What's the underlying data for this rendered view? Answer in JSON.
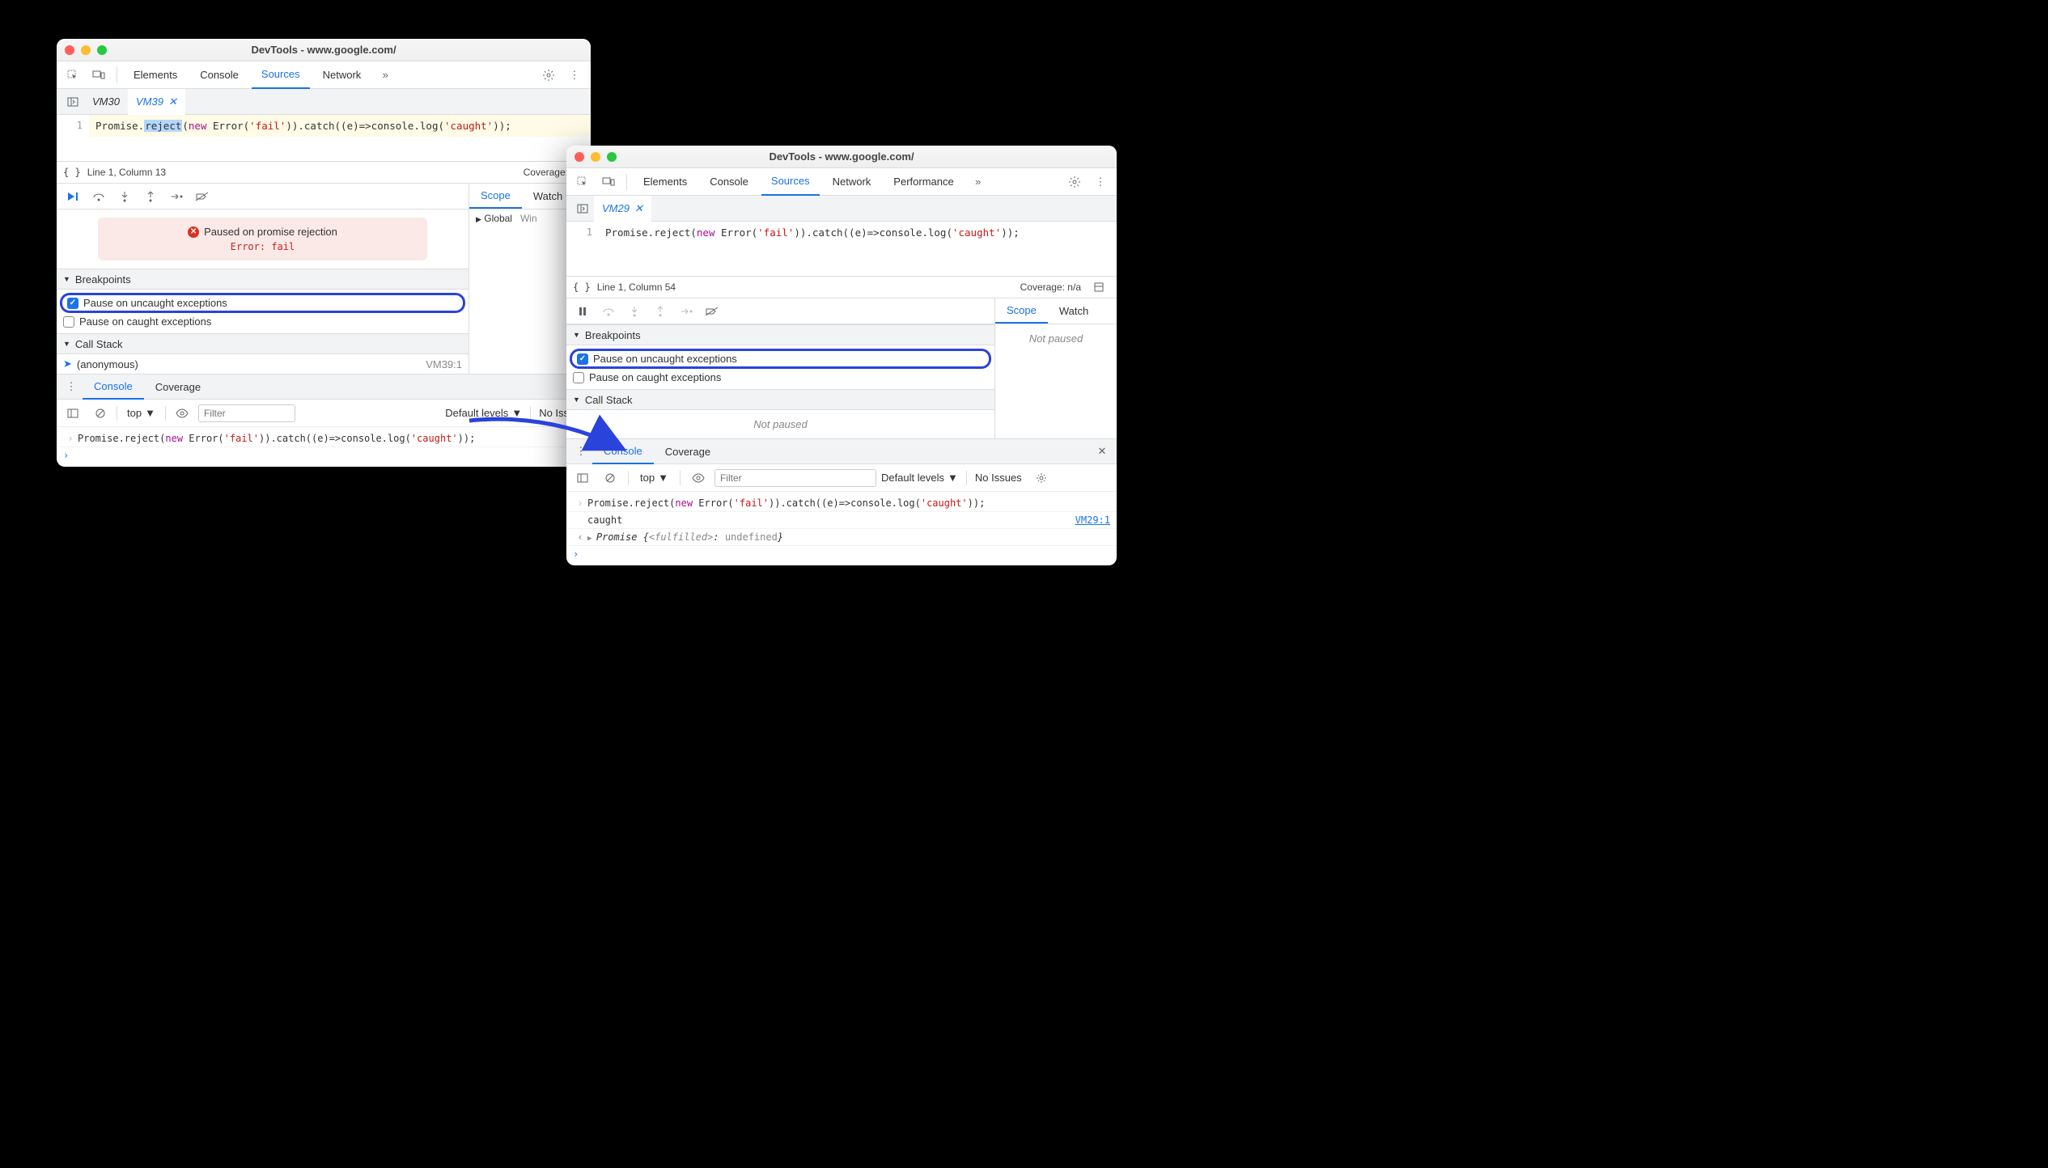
{
  "left": {
    "title": "DevTools - www.google.com/",
    "panels": [
      "Elements",
      "Console",
      "Sources",
      "Network"
    ],
    "activePanel": "Sources",
    "more": "»",
    "fileTabs": {
      "inactive": "VM30",
      "active": "VM39"
    },
    "editor": {
      "lineNo": "1",
      "tokens": {
        "t0": "Promise.",
        "t1": "reject",
        "t2": "(",
        "t3": "new",
        "t4": " Error(",
        "t5": "'fail'",
        "t6": ")).catch((e)=>console.log(",
        "t7": "'caught'",
        "t8": "));"
      }
    },
    "status": {
      "pos": "Line 1, Column 13",
      "coverage": "Coverage: n/a"
    },
    "rightPane": {
      "tabs": [
        "Scope",
        "Watch"
      ],
      "activeTab": "Scope",
      "scope": {
        "globalLabel": "Global",
        "globalVal": "Win"
      }
    },
    "pauseBanner": {
      "title": "Paused on promise rejection",
      "error": "Error: fail"
    },
    "breakpoints": {
      "header": "Breakpoints",
      "uncaught": "Pause on uncaught exceptions",
      "caught": "Pause on caught exceptions"
    },
    "callstack": {
      "header": "Call Stack",
      "frame": "(anonymous)",
      "frameLoc": "VM39:1"
    },
    "drawer": {
      "tabs": [
        "Console",
        "Coverage"
      ],
      "activeTab": "Console",
      "context": "top",
      "filterPlaceholder": "Filter",
      "levels": "Default levels",
      "issues": "No Issues",
      "rows": [
        {
          "kind": "input",
          "tokens": {
            "t0": "Promise.reject(",
            "t1": "new",
            "t2": " Error(",
            "t3": "'fail'",
            "t4": ")).catch((e)=>console.log(",
            "t5": "'caught'",
            "t6": "));"
          }
        }
      ]
    }
  },
  "right": {
    "title": "DevTools - www.google.com/",
    "panels": [
      "Elements",
      "Console",
      "Sources",
      "Network",
      "Performance"
    ],
    "activePanel": "Sources",
    "more": "»",
    "fileTabs": {
      "active": "VM29"
    },
    "editor": {
      "lineNo": "1",
      "tokens": {
        "t0": "Promise.reject(",
        "t1": "new",
        "t2": " Error(",
        "t3": "'fail'",
        "t4": ")).catch((e)=>console.log(",
        "t5": "'caught'",
        "t6": "));"
      }
    },
    "status": {
      "pos": "Line 1, Column 54",
      "coverage": "Coverage: n/a"
    },
    "rightPane": {
      "tabs": [
        "Scope",
        "Watch"
      ],
      "activeTab": "Scope",
      "notPaused": "Not paused"
    },
    "breakpoints": {
      "header": "Breakpoints",
      "uncaught": "Pause on uncaught exceptions",
      "caught": "Pause on caught exceptions"
    },
    "callstack": {
      "header": "Call Stack",
      "notPaused": "Not paused"
    },
    "drawer": {
      "tabs": [
        "Console",
        "Coverage"
      ],
      "activeTab": "Console",
      "context": "top",
      "filterPlaceholder": "Filter",
      "levels": "Default levels",
      "issues": "No Issues",
      "rows": [
        {
          "kind": "input",
          "tokens": {
            "t0": "Promise.reject(",
            "t1": "new",
            "t2": " Error(",
            "t3": "'fail'",
            "t4": ")).catch((e)=>console.log(",
            "t5": "'caught'",
            "t6": "));"
          }
        },
        {
          "kind": "log",
          "msg": "caught",
          "src": "VM29:1"
        },
        {
          "kind": "result",
          "prefix": "Promise {",
          "state": "<fulfilled>",
          "sep": ": ",
          "val": "undefined",
          "suffix": "}"
        }
      ]
    }
  }
}
